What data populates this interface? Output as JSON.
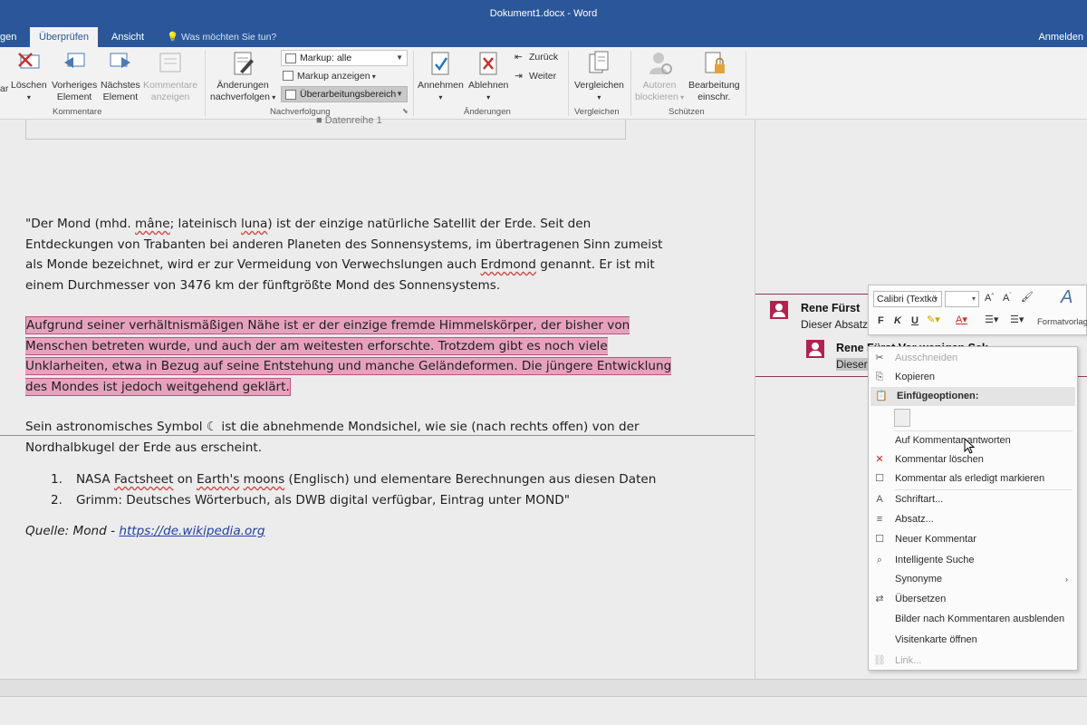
{
  "window": {
    "title": "Dokument1.docx - Word",
    "signin": "Anmelden"
  },
  "tabs": [
    {
      "label": "gen",
      "active": false
    },
    {
      "label": "Überprüfen",
      "active": true
    },
    {
      "label": "Ansicht",
      "active": false
    }
  ],
  "tell_me": "Was möchten Sie tun?",
  "ribbon": {
    "kommentare": {
      "label": "Kommentare",
      "partial": "ar",
      "loeschen": "Löschen",
      "vorheriges": [
        "Vorheriges",
        "Element"
      ],
      "naechstes": [
        "Nächstes",
        "Element"
      ],
      "anzeigen": [
        "Kommentare",
        "anzeigen"
      ]
    },
    "nachverfolgung": {
      "label": "Nachverfolgung",
      "aenderungen": [
        "Änderungen",
        "nachverfolgen"
      ],
      "markup_select": "Markup: alle",
      "markup_anzeigen": "Markup anzeigen",
      "ueberarbeitungsbereich": "Überarbeitungsbereich"
    },
    "aenderungen": {
      "label": "Änderungen",
      "annehmen": "Annehmen",
      "ablehnen": "Ablehnen",
      "zurueck": "Zurück",
      "weiter": "Weiter"
    },
    "vergleichen": {
      "label": "Vergleichen",
      "button": "Vergleichen"
    },
    "schuetzen": {
      "label": "Schützen",
      "autoren": [
        "Autoren",
        "blockieren"
      ],
      "bearbeitung": [
        "Bearbeitung",
        "einschr."
      ]
    }
  },
  "document": {
    "frame_text": "Datenreihe 1",
    "p1": {
      "a": "\"Der Mond (mhd. ",
      "w1": "mâne",
      "b": "; lateinisch ",
      "w2": "luna",
      "c": ") ist der einzige natürliche Satellit der Erde. Seit den Entdeckungen von Trabanten bei anderen Planeten des Sonnensystems, im übertragenen Sinn zumeist als Monde bezeichnet, wird er zur Vermeidung von Verwechslungen auch ",
      "w3": "Erdmond",
      "d": " genannt. Er ist mit einem Durchmesser von 3476 km der fünftgrößte Mond des Sonnensystems."
    },
    "p2": "Aufgrund seiner verhältnismäßigen Nähe ist er der einzige fremde Himmelskörper, der bisher von Menschen betreten wurde, und auch der am weitesten erforschte. Trotzdem gibt es noch viele Unklarheiten, etwa in Bezug auf seine Entstehung und manche Geländeformen. Die jüngere Entwicklung des Mondes ist jedoch weitgehend geklärt.",
    "p3": "Sein astronomisches Symbol ☾ ist die abnehmende Mondsichel, wie sie (nach rechts offen) von der Nordhalbkugel der Erde aus erscheint.",
    "list": [
      {
        "num": "1.",
        "a": "NASA ",
        "w1": "Factsheet",
        "b": " on ",
        "w2": "Earth's",
        "c": " ",
        "w3": "moons",
        "d": " (Englisch) und elementare Berechnungen aus diesen Daten"
      },
      {
        "num": "2.",
        "text": "Grimm: Deutsches Wörterbuch, als DWB digital verfügbar, Eintrag unter MOND\""
      }
    ],
    "quote_prefix": "Quelle: Mond - ",
    "quote_link": "https://de.wikipedia.org"
  },
  "comments": [
    {
      "author": "Rene Fürst",
      "text": "Dieser Absatz"
    },
    {
      "author": "Rene Fürst  Vor wenigen Sek",
      "text": "Dieser"
    }
  ],
  "mini_toolbar": {
    "font": "Calibri (Textkö",
    "bold": "F",
    "italic": "K",
    "underline": "U",
    "format_label": "Formatvorlagen"
  },
  "context_menu": [
    {
      "label": "Ausschneiden",
      "icon": "✂",
      "disabled": true
    },
    {
      "label": "Kopieren",
      "icon": "⎘",
      "disabled": false
    },
    {
      "label": "Einfügeoptionen:",
      "icon": "📋",
      "disabled": false,
      "header": true
    },
    {
      "label": "Auf Kommentar antworten",
      "icon": "",
      "disabled": false
    },
    {
      "label": "Kommentar löschen",
      "icon": "✕",
      "disabled": false
    },
    {
      "label": "Kommentar als erledigt markieren",
      "icon": "☐",
      "disabled": false
    },
    {
      "label": "Schriftart...",
      "icon": "A",
      "disabled": false
    },
    {
      "label": "Absatz...",
      "icon": "≡",
      "disabled": false
    },
    {
      "label": "Neuer Kommentar",
      "icon": "☐",
      "disabled": false
    },
    {
      "label": "Intelligente Suche",
      "icon": "⌕",
      "disabled": false
    },
    {
      "label": "Synonyme",
      "icon": "",
      "disabled": false,
      "submenu": "›"
    },
    {
      "label": "Übersetzen",
      "icon": "⇄",
      "disabled": false
    },
    {
      "label": "Bilder nach Kommentaren ausblenden",
      "icon": "",
      "disabled": false
    },
    {
      "label": "Visitenkarte öffnen",
      "icon": "",
      "disabled": false
    },
    {
      "label": "Link...",
      "icon": "⛓",
      "disabled": true
    }
  ],
  "colors": {
    "titlebar": "#2b579a",
    "highlight": "#e6a2bc",
    "avatar": "#b2224f"
  }
}
